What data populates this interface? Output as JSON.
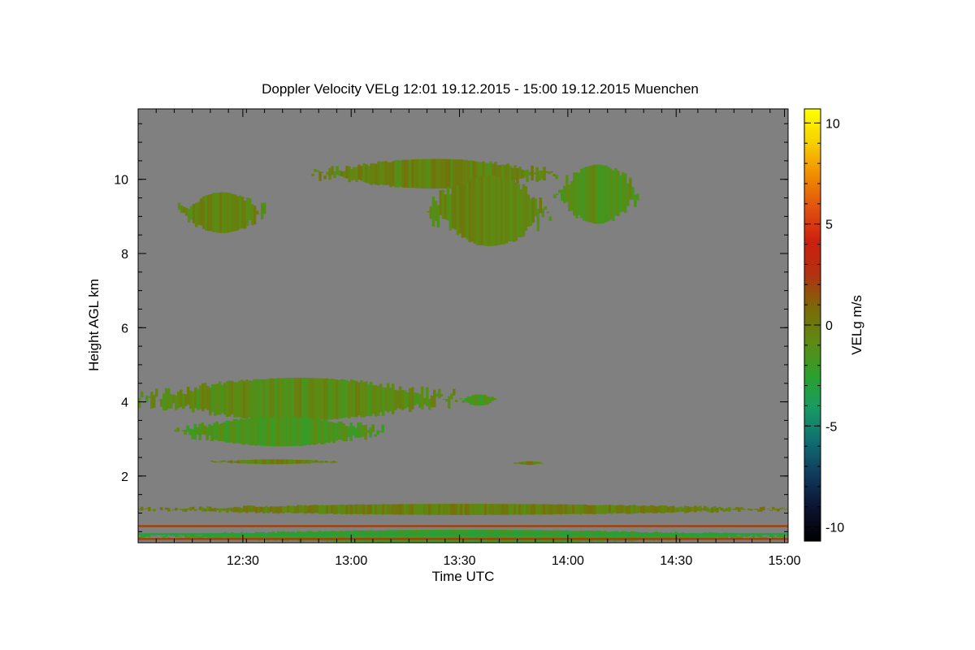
{
  "chart_data": {
    "type": "heatmap",
    "title": "Doppler Velocity VELg   12:01 19.12.2015 - 15:00 19.12.2015 Muenchen",
    "xlabel": "Time UTC",
    "ylabel": "Height AGL km",
    "colorbar_label": "VELg m/s",
    "x_range_minutes": [
      0,
      180
    ],
    "x_range_times": [
      "12:01",
      "15:00"
    ],
    "y_range": [
      0.2,
      11.9
    ],
    "clim": [
      -10.7,
      10.7
    ],
    "x_ticks": [
      {
        "minute": 29,
        "label": "12:30"
      },
      {
        "minute": 59,
        "label": "13:00"
      },
      {
        "minute": 89,
        "label": "13:30"
      },
      {
        "minute": 119,
        "label": "14:00"
      },
      {
        "minute": 149,
        "label": "14:30"
      },
      {
        "minute": 179,
        "label": "15:00"
      }
    ],
    "y_ticks": [
      {
        "value": 2,
        "label": "2"
      },
      {
        "value": 4,
        "label": "4"
      },
      {
        "value": 6,
        "label": "6"
      },
      {
        "value": 8,
        "label": "8"
      },
      {
        "value": 10,
        "label": "10"
      }
    ],
    "colorbar_ticks": [
      {
        "value": 10,
        "label": "10"
      },
      {
        "value": 5,
        "label": "5"
      },
      {
        "value": 0,
        "label": "0"
      },
      {
        "value": -5,
        "label": "-5"
      },
      {
        "value": -10,
        "label": "-10"
      }
    ],
    "colormap": [
      "#000000",
      "#0b1330",
      "#103a5c",
      "#0f6e72",
      "#199a62",
      "#2ca02c",
      "#5e8a12",
      "#7a6a08",
      "#b03210",
      "#cc2010",
      "#e05010",
      "#f08c00",
      "#f8d000",
      "#ffff00"
    ],
    "background_color": "#808080",
    "echo_regions": [
      {
        "t0": 11,
        "t1": 35,
        "h0": 8.55,
        "h1": 9.65,
        "velocity": -0.6
      },
      {
        "t0": 48,
        "t1": 116,
        "h0": 9.75,
        "h1": 10.55,
        "velocity": -0.4
      },
      {
        "t0": 80,
        "t1": 114,
        "h0": 8.2,
        "h1": 10.1,
        "velocity": -0.5
      },
      {
        "t0": 115,
        "t1": 139,
        "h0": 8.8,
        "h1": 10.4,
        "velocity": -1.2
      },
      {
        "t0": 0,
        "t1": 88,
        "h0": 3.5,
        "h1": 4.65,
        "velocity": -0.8
      },
      {
        "t0": 10,
        "t1": 68,
        "h0": 2.8,
        "h1": 3.6,
        "velocity": -1.5
      },
      {
        "t0": 89,
        "t1": 99,
        "h0": 3.9,
        "h1": 4.2,
        "velocity": -1.6
      },
      {
        "t0": 20,
        "t1": 55,
        "h0": 2.32,
        "h1": 2.45,
        "velocity": -0.2
      },
      {
        "t0": 104,
        "t1": 112,
        "h0": 2.3,
        "h1": 2.4,
        "velocity": -0.3
      },
      {
        "t0": 0,
        "t1": 180,
        "h0": 0.95,
        "h1": 1.25,
        "velocity": -0.2
      },
      {
        "t0": 0,
        "t1": 180,
        "h0": 0.2,
        "h1": 0.55,
        "velocity": -2.0
      }
    ],
    "band_lines": [
      {
        "h": 0.65,
        "velocity": 2.0
      },
      {
        "h": 0.43,
        "velocity": -3.0
      },
      {
        "h": 0.3,
        "velocity": 2.0
      }
    ]
  }
}
